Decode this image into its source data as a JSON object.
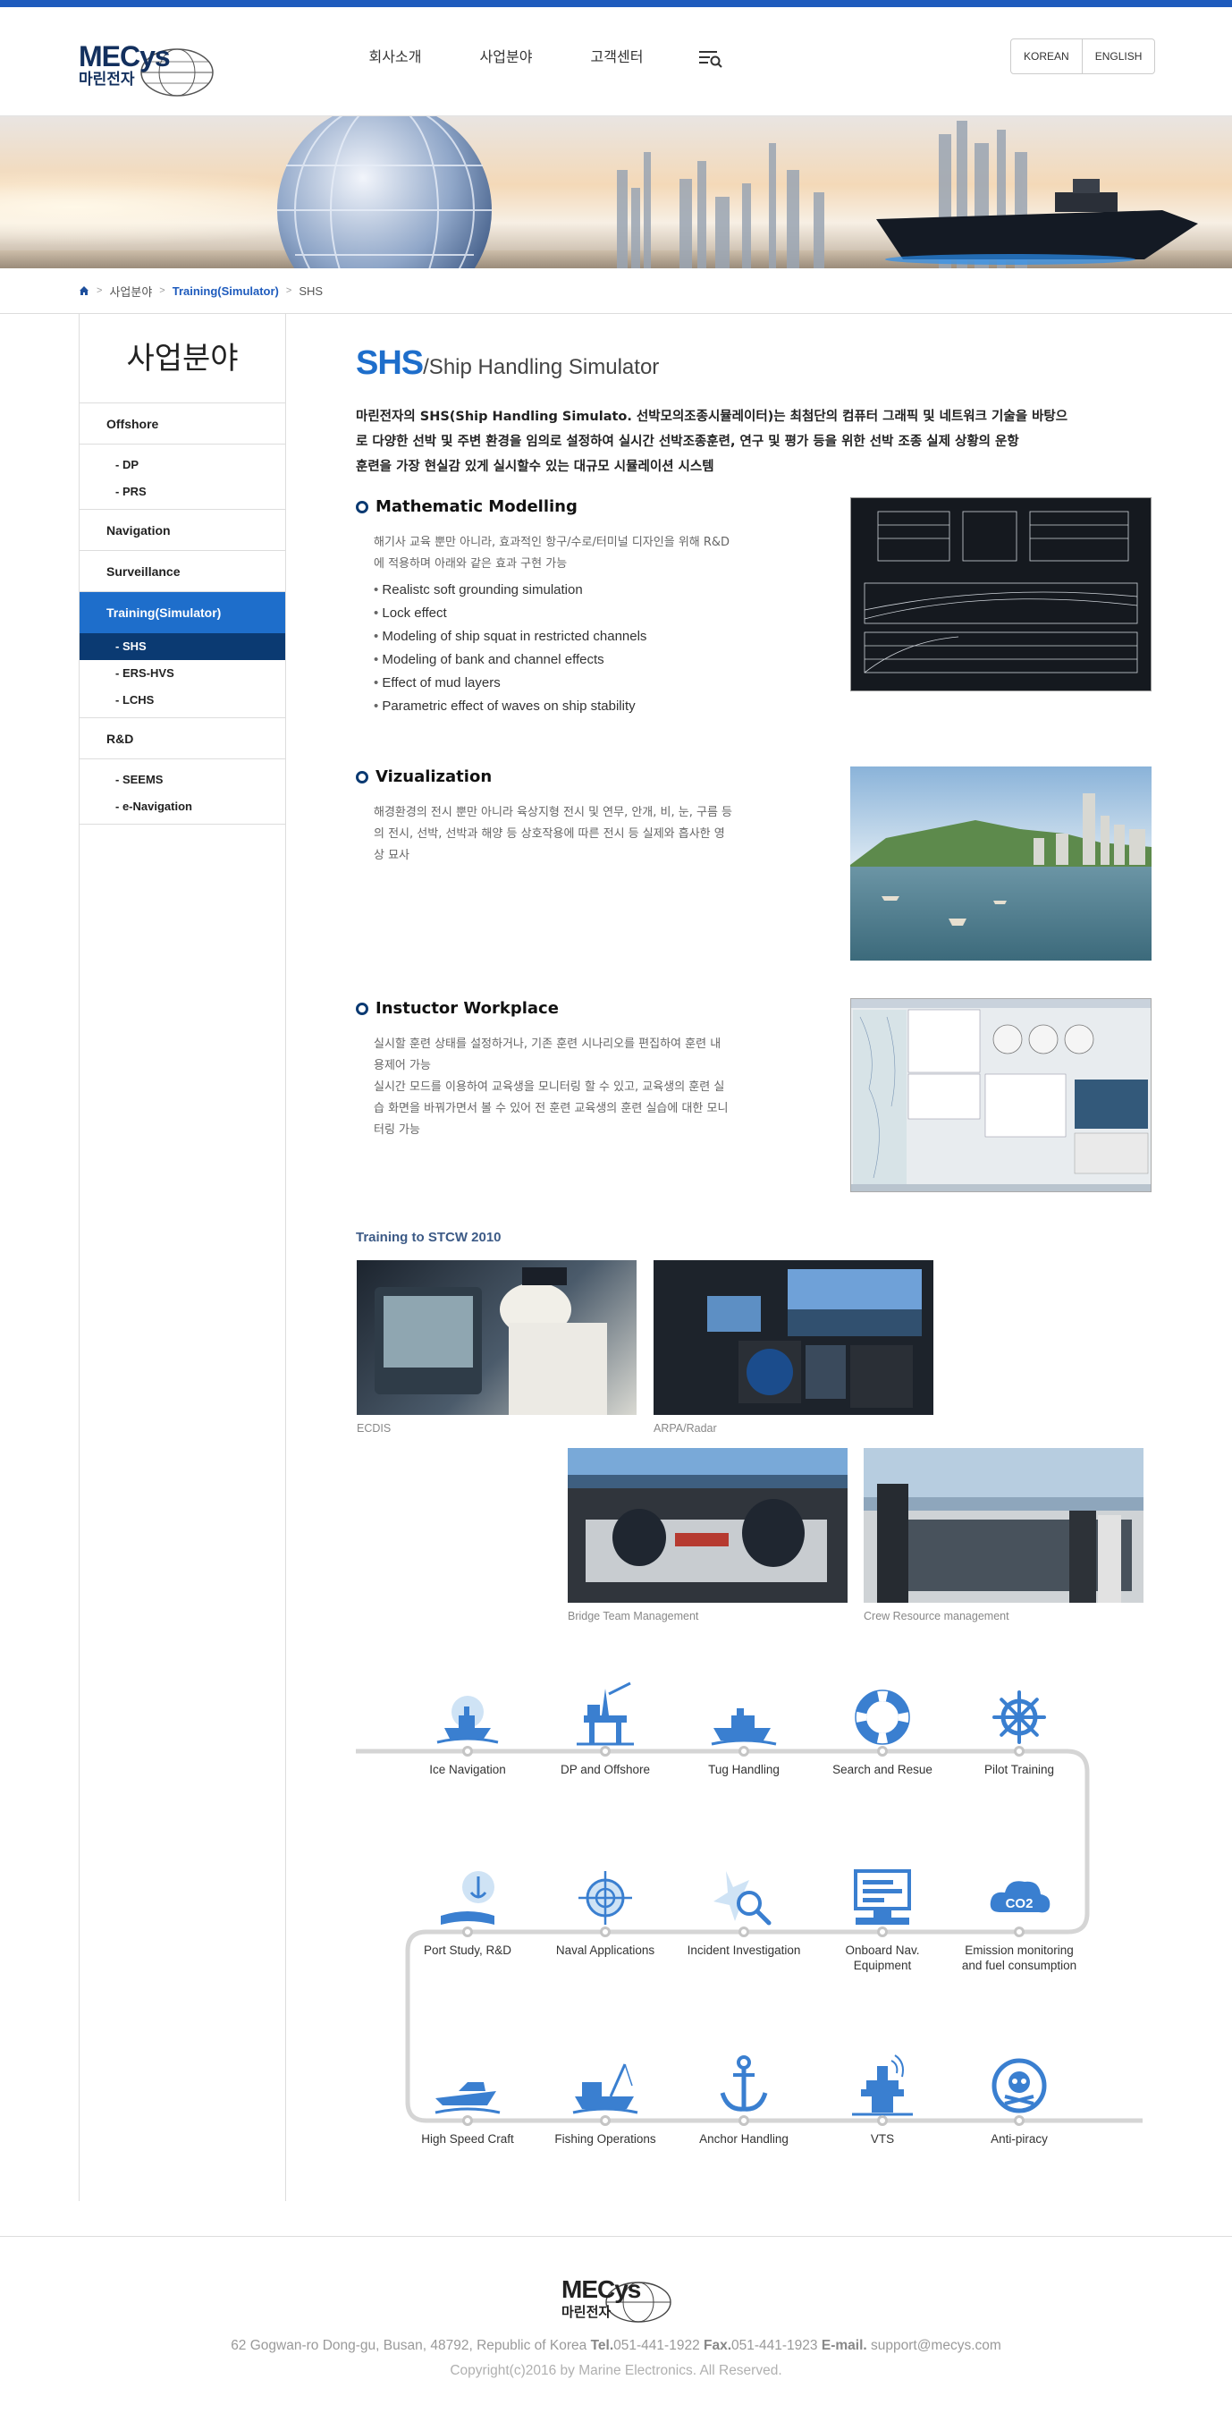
{
  "header": {
    "logo": {
      "brand": "MECys",
      "korean": "마린전자"
    },
    "nav": [
      "회사소개",
      "사업분야",
      "고객센터"
    ],
    "menu_icon": "menu-search-icon",
    "languages": [
      "KOREAN",
      "ENGLISH"
    ]
  },
  "breadcrumb": {
    "home_icon": "home-icon",
    "items": [
      "사업분야",
      "Training(Simulator)",
      "SHS"
    ]
  },
  "sidebar": {
    "title": "사업분야",
    "offshore": {
      "label": "Offshore",
      "subs": [
        "DP",
        "PRS"
      ]
    },
    "navigation": {
      "label": "Navigation"
    },
    "surveillance": {
      "label": "Surveillance"
    },
    "training": {
      "label": "Training(Simulator)",
      "subs": [
        "SHS",
        "ERS-HVS",
        "LCHS"
      ]
    },
    "rnd": {
      "label": "R&D",
      "subs": [
        "SEEMS",
        "e-Navigation"
      ]
    }
  },
  "page": {
    "title_big": "SHS",
    "title_small": "/Ship Handling Simulator",
    "intro_lines": [
      "마린전자의 SHS(Ship Handling Simulato. 선박모의조종시뮬레이터)는 최첨단의 컴퓨터 그래픽 및 네트워크 기술을 바탕으",
      "로 다양한 선박 및 주변 환경을 임의로 설정하여 실시간 선박조종훈련, 연구 및 평가 등을 위한 선박 조종 실제 상황의 운항",
      "훈련을 가장 현실감 있게 실시할수 있는 대규모 시뮬레이션 시스템"
    ]
  },
  "sections": [
    {
      "title": "Mathematic Modelling",
      "desc_lines": [
        "해기사 교육 뿐만 아니라, 효과적인 항구/수로/터미널 디자인을 위해 R&D",
        "에 적용하며 아래와 같은 효과 구현 가능"
      ],
      "bullets": [
        "Realistc soft grounding simulation",
        "Lock effect",
        "Modeling of ship squat in restricted channels",
        "Modeling of bank and channel effects",
        "Effect of mud layers",
        "Parametric effect of waves on ship stability"
      ]
    },
    {
      "title": "Vizualization",
      "desc_lines": [
        "해경환경의 전시 뿐만 아니라 육상지형 전시 및 연무, 안개, 비, 눈, 구름 등",
        "의 전시, 선박, 선박과 해양 등 상호작용에 따른 전시 등 실제와 흡사한 영",
        "상 묘사"
      ]
    },
    {
      "title": "Instuctor Workplace",
      "desc_lines": [
        "실시할 훈련 상태를 설정하거나, 기존 훈련 시나리오를 편집하여 훈련 내",
        "용제어 가능",
        "실시간 모드를 이용하여 교육생을 모니터링 할 수 있고, 교육생의 훈련 실",
        "습 화면을 바꿔가면서 볼 수 있어 전 훈련 교육생의 훈련 실습에 대한 모니",
        "터링 가능"
      ]
    }
  ],
  "stcw": {
    "title": "Training to STCW 2010",
    "photos": [
      "ECDIS",
      "ARPA/Radar",
      "Bridge Team Management",
      "Crew Resource management"
    ]
  },
  "applications": {
    "row1": [
      "Ice Navigation",
      "DP and Offshore",
      "Tug Handling",
      "Search and Resue",
      "Pilot Training"
    ],
    "row2": [
      "Port Study, R&D",
      "Naval Applications",
      "Incident Investigation",
      "Onboard Nav.|Equipment",
      "Emission monitoring|and fuel consumption"
    ],
    "row3": [
      "High Speed Craft",
      "Fishing Operations",
      "Anchor Handling",
      "VTS",
      "Anti-piracy"
    ],
    "co2_label": "CO2",
    "icon_color": "#3a7fd0"
  },
  "footer": {
    "logo": {
      "brand": "MECys",
      "korean": "마린전자"
    },
    "address": "62 Gogwan-ro Dong-gu, Busan, 48792, Republic of Korea",
    "tel_label": "Tel.",
    "tel": "051-441-1922",
    "fax_label": "Fax.",
    "fax": "051-441-1923",
    "email_label": "E-mail.",
    "email": "support@mecys.com",
    "copyright": "Copyright(c)2016 by Marine Electronics. All Reserved."
  },
  "colors": {
    "brand_blue": "#1e6ecb",
    "dark_navy": "#0b3a72",
    "top_bar": "#1e5bbd"
  }
}
